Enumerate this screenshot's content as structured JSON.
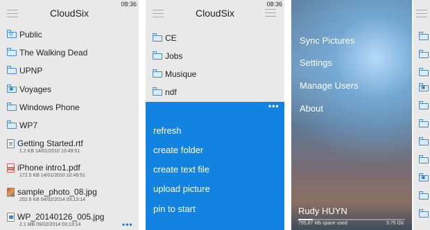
{
  "status": {
    "time": "08:36"
  },
  "screen1": {
    "title": "CloudSix",
    "folders": [
      {
        "name": "Public",
        "icon": "shared-folder-icon"
      },
      {
        "name": "The Walking Dead",
        "icon": "folder-icon"
      },
      {
        "name": "UPNP",
        "icon": "folder-icon"
      },
      {
        "name": "Voyages",
        "icon": "photo-folder-icon"
      },
      {
        "name": "Windows Phone",
        "icon": "folder-icon"
      },
      {
        "name": "WP7",
        "icon": "folder-icon"
      }
    ],
    "files": [
      {
        "name": "Getting Started.rtf",
        "meta": "1.2 KB 14/01/2010 10:49:51",
        "icon": "document-icon"
      },
      {
        "name": "iPhone intro1.pdf",
        "meta": "172.5 KB 14/01/2010 10:49:51",
        "icon": "pdf-icon"
      },
      {
        "name": "sample_photo_08.jpg",
        "meta": "202.6 KB 04/02/2014 03:13:14",
        "icon": "photo-thumbnail-icon"
      },
      {
        "name": "WP_20140126_005.jpg",
        "meta": "2.1 MB 09/02/2014 03:13:14",
        "icon": "image-icon"
      }
    ],
    "more": "•••"
  },
  "screen2": {
    "title": "CloudSix",
    "folders": [
      "CE",
      "Jobs",
      "Musique",
      "ndf"
    ],
    "more": "•••",
    "menu": [
      "refresh",
      "create folder",
      "create text file",
      "upload picture",
      "pin to start"
    ]
  },
  "screen3": {
    "items": [
      "Sync Pictures",
      "Settings",
      "Manage Users",
      "About"
    ],
    "user": "Rudy HUYN",
    "space_used": "795,87 Mb space used",
    "space_total": "5.75 Gb",
    "usage_fraction": 0.135
  },
  "colors": {
    "accent": "#1283e0",
    "folder": "#3f89cc",
    "panel": "#e9e9e9"
  }
}
